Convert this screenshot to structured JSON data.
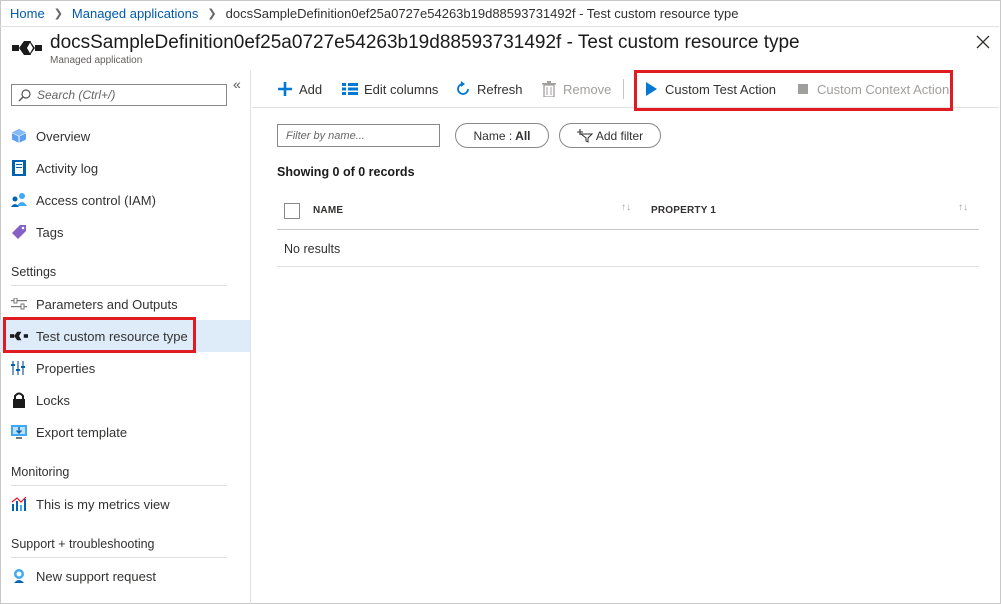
{
  "breadcrumb": {
    "items": [
      "Home",
      "Managed applications"
    ],
    "current": "docsSampleDefinition0ef25a0727e54263b19d88593731492f - Test custom resource type"
  },
  "header": {
    "title": "docsSampleDefinition0ef25a0727e54263b19d88593731492f - Test custom resource type",
    "subtitle": "Managed application"
  },
  "sidebar": {
    "search_placeholder": "Search (Ctrl+/)",
    "items_top": [
      {
        "label": "Overview",
        "icon": "cube-icon"
      },
      {
        "label": "Activity log",
        "icon": "activity-log-icon"
      },
      {
        "label": "Access control (IAM)",
        "icon": "people-icon"
      },
      {
        "label": "Tags",
        "icon": "tag-icon"
      }
    ],
    "section_settings": "Settings",
    "items_settings": [
      {
        "label": "Parameters and Outputs",
        "icon": "parameters-icon"
      },
      {
        "label": "Test custom resource type",
        "icon": "custom-resource-icon"
      },
      {
        "label": "Properties",
        "icon": "properties-icon"
      },
      {
        "label": "Locks",
        "icon": "lock-icon"
      },
      {
        "label": "Export template",
        "icon": "export-icon"
      }
    ],
    "section_monitoring": "Monitoring",
    "items_monitoring": [
      {
        "label": "This is my metrics view",
        "icon": "metrics-icon"
      }
    ],
    "section_support": "Support + troubleshooting",
    "items_support": [
      {
        "label": "New support request",
        "icon": "support-icon"
      }
    ]
  },
  "toolbar": {
    "add": "Add",
    "edit_columns": "Edit columns",
    "refresh": "Refresh",
    "remove": "Remove",
    "custom_test_action": "Custom Test Action",
    "custom_context_action": "Custom Context Action"
  },
  "main": {
    "filter_placeholder": "Filter by name...",
    "name_filter_label": "Name :",
    "name_filter_value": "All",
    "add_filter": "Add filter",
    "records": "Showing 0 of 0 records",
    "columns": [
      "NAME",
      "PROPERTY 1"
    ],
    "empty": "No results"
  },
  "colors": {
    "accent": "#0078d4",
    "highlight": "#e01b22",
    "active_bg": "#deecf9"
  }
}
